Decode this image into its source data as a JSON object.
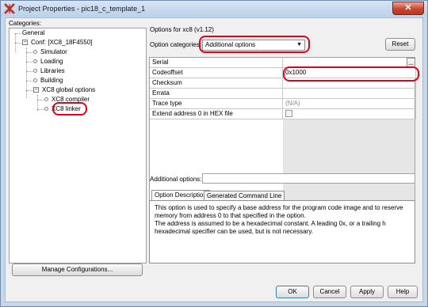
{
  "window": {
    "title": "Project Properties - pic18_c_template_1",
    "close_symbol": "✕"
  },
  "categories": {
    "label": "Categories:",
    "items": [
      {
        "label": "General"
      },
      {
        "label": "Conf: [XC8_18F4550]"
      },
      {
        "label": "Simulator"
      },
      {
        "label": "Loading"
      },
      {
        "label": "Libraries"
      },
      {
        "label": "Building"
      },
      {
        "label": "XC8 global options"
      },
      {
        "label": "XC8 compiler"
      },
      {
        "label": "XC8 linker"
      }
    ],
    "expand_symbol": "−"
  },
  "options": {
    "header": "Options for xc8 (v1.12)",
    "categories_label": "Option categories:",
    "categories_value": "Additional options",
    "reset_label": "Reset",
    "rows": [
      {
        "name": "Serial",
        "value": "",
        "browse": "..."
      },
      {
        "name": "Codeoffset",
        "value": "0x1000"
      },
      {
        "name": "Checksum",
        "value": ""
      },
      {
        "name": "Errata",
        "value": ""
      },
      {
        "name": "Trace type",
        "value": "(N/A)"
      },
      {
        "name": "Extend address 0 in HEX file",
        "value": ""
      }
    ],
    "additional_options_label": "Additional options:",
    "additional_options_value": ""
  },
  "tabs": [
    {
      "label": "Option Description"
    },
    {
      "label": "Generated Command Line"
    }
  ],
  "description": {
    "line1": "This option is used to specify a base address for the program code image and to reserve memory from address 0 to that specified in the option.",
    "line2": "The address is assumed to be a hexadecimal constant. A leading 0x, or a trailing h hexadecimal specifier can be used, but is not necessary."
  },
  "buttons": {
    "manage": "Manage Configurations...",
    "ok": "OK",
    "cancel": "Cancel",
    "apply": "Apply",
    "help": "Help"
  },
  "colors": {
    "highlight_red": "#e2001a",
    "title_bar": "#c6d7ea"
  }
}
